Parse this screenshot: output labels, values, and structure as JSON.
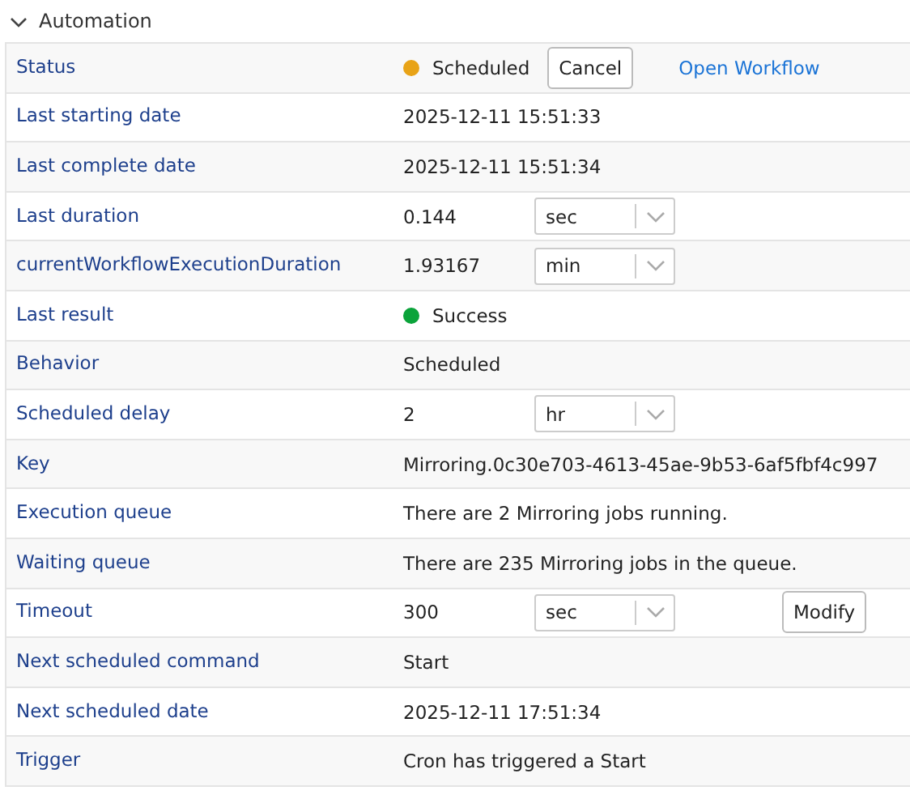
{
  "section": {
    "title": "Automation",
    "expanded": true
  },
  "rows": [
    {
      "label": "Status",
      "kind": "status",
      "color": "#e8a317",
      "value": "Scheduled",
      "button": "Cancel",
      "link": "Open Workflow"
    },
    {
      "label": "Last starting date",
      "kind": "text",
      "value": "2025-12-11 15:51:33"
    },
    {
      "label": "Last complete date",
      "kind": "text",
      "value": "2025-12-11 15:51:34"
    },
    {
      "label": "Last duration",
      "kind": "unit",
      "value": "0.144",
      "unit": "sec"
    },
    {
      "label": "currentWorkflowExecutionDuration",
      "kind": "unit",
      "value": "1.93167",
      "unit": "min"
    },
    {
      "label": "Last result",
      "kind": "status",
      "color": "#0aa33a",
      "value": "Success"
    },
    {
      "label": "Behavior",
      "kind": "text",
      "value": "Scheduled"
    },
    {
      "label": "Scheduled delay",
      "kind": "unit",
      "value": "2",
      "unit": "hr"
    },
    {
      "label": "Key",
      "kind": "text",
      "value": "Mirroring.0c30e703-4613-45ae-9b53-6af5fbf4c997"
    },
    {
      "label": "Execution queue",
      "kind": "text",
      "value": "There are 2 Mirroring jobs running."
    },
    {
      "label": "Waiting queue",
      "kind": "text",
      "value": "There are 235 Mirroring jobs in the queue."
    },
    {
      "label": "Timeout",
      "kind": "unit",
      "value": "300",
      "unit": "sec",
      "button": "Modify"
    },
    {
      "label": "Next scheduled command",
      "kind": "text",
      "value": "Start"
    },
    {
      "label": "Next scheduled date",
      "kind": "text",
      "value": "2025-12-11 17:51:34"
    },
    {
      "label": "Trigger",
      "kind": "text",
      "value": "Cron has triggered a Start"
    }
  ]
}
